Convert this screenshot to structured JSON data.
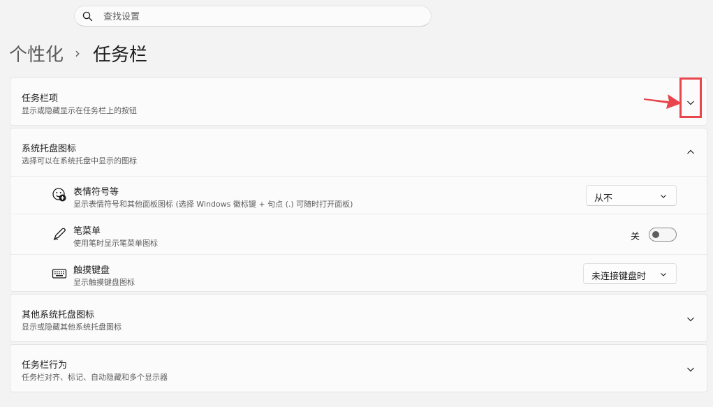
{
  "search": {
    "placeholder": "查找设置"
  },
  "breadcrumb": {
    "parent": "个性化",
    "separator": "›",
    "current": "任务栏"
  },
  "sections": {
    "taskbar_items": {
      "title": "任务栏项",
      "description": "显示或隐藏显示在任务栏上的按钮"
    },
    "system_tray": {
      "title": "系统托盘图标",
      "description": "选择可以在系统托盘中显示的图标",
      "items": [
        {
          "title": "表情符号等",
          "description": "显示表情符号和其他面板图标 (选择 Windows 徽标键 + 句点 (.) 可随时打开面板)",
          "control": "dropdown",
          "value": "从不",
          "icon": "emoji-icon"
        },
        {
          "title": "笔菜单",
          "description": "使用笔时显示笔菜单图标",
          "control": "toggle",
          "value": "关",
          "icon": "pen-icon"
        },
        {
          "title": "触摸键盘",
          "description": "显示触摸键盘图标",
          "control": "dropdown",
          "value": "未连接键盘时",
          "icon": "keyboard-icon"
        }
      ]
    },
    "other_tray": {
      "title": "其他系统托盘图标",
      "description": "显示或隐藏其他系统托盘图标"
    },
    "behaviors": {
      "title": "任务栏行为",
      "description": "任务栏对齐、标记、自动隐藏和多个显示器"
    }
  },
  "colors": {
    "annotation": "#e8454d",
    "background": "#f3f3f3",
    "card": "#fbfbfb"
  }
}
